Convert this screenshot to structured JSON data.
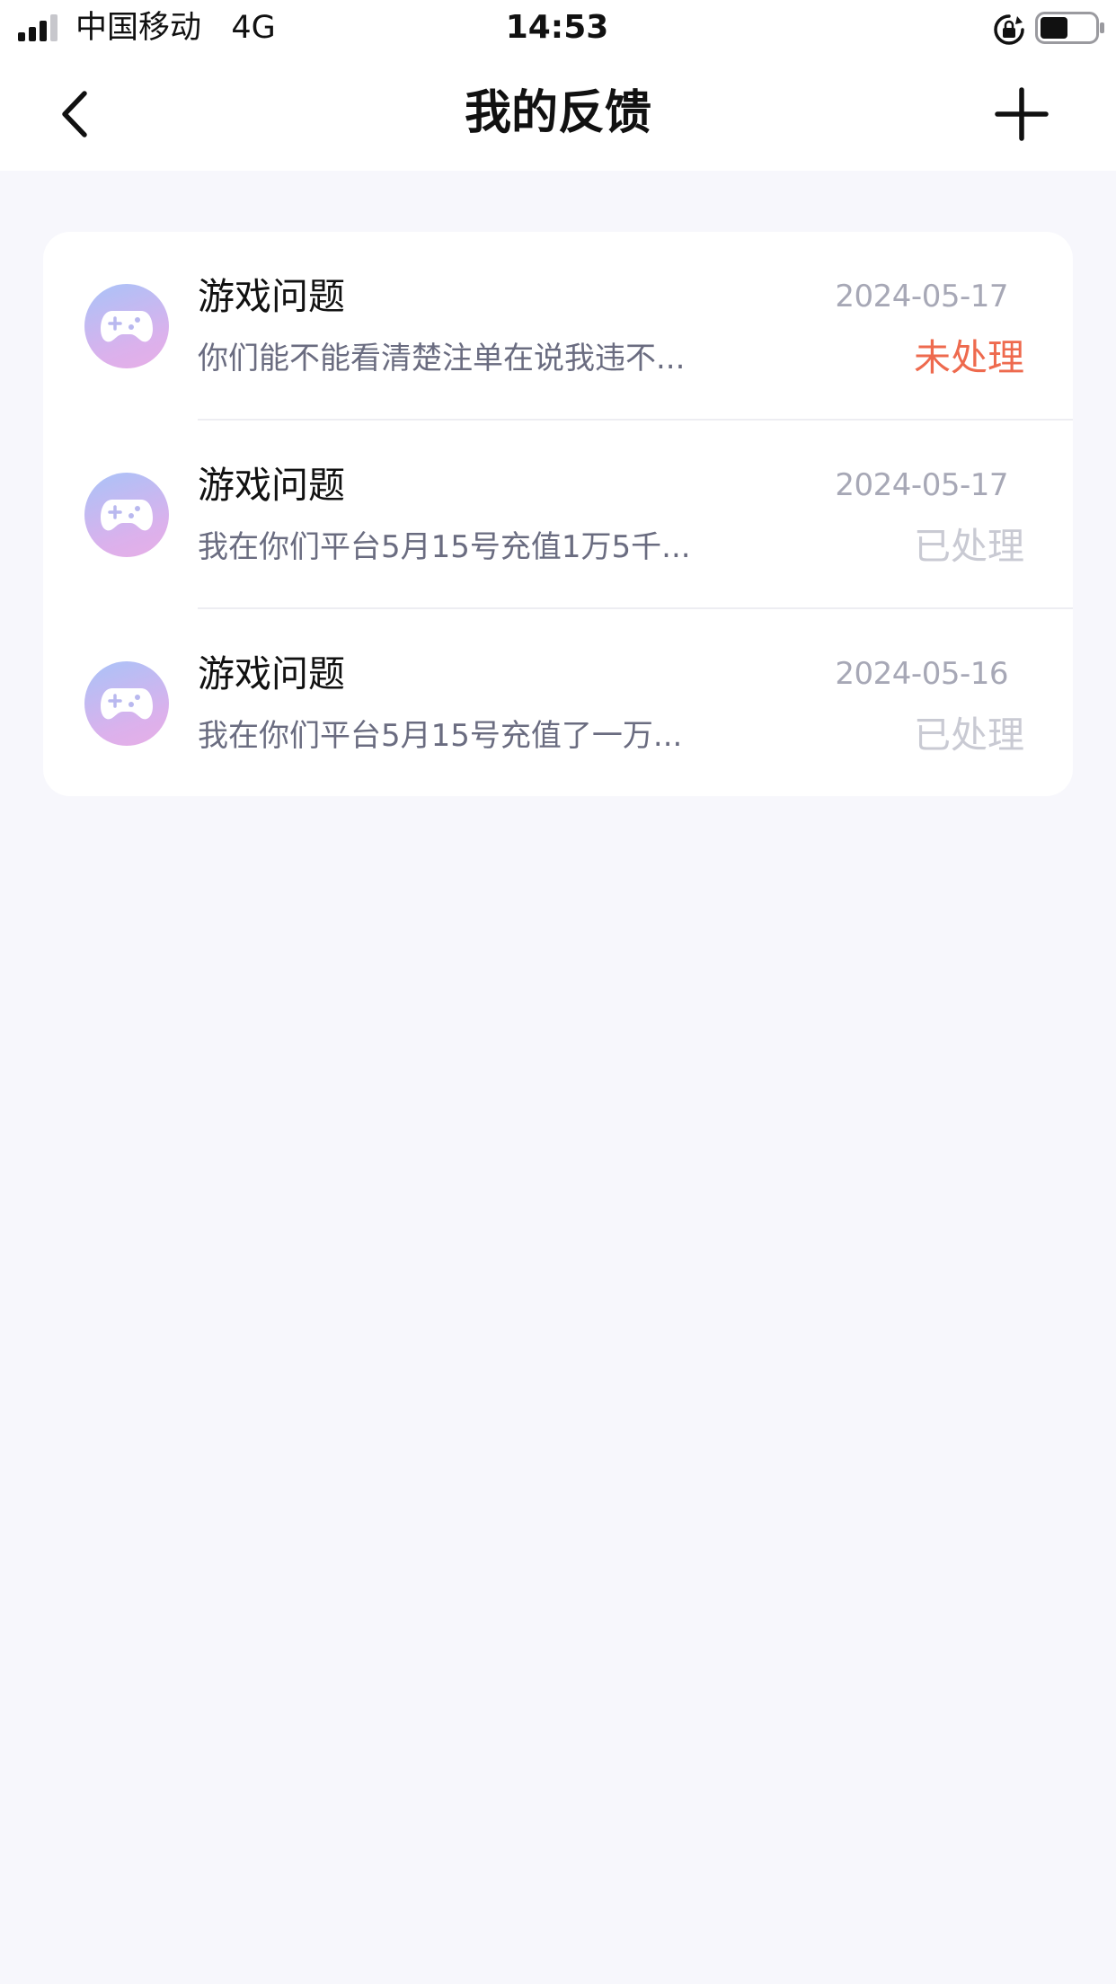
{
  "status_bar": {
    "carrier": "中国移动",
    "network": "4G",
    "time": "14:53",
    "icons": [
      "signal-icon",
      "rotation-lock-icon",
      "battery-icon"
    ]
  },
  "nav": {
    "title": "我的反馈",
    "back_icon": "chevron-left-icon",
    "add_icon": "plus-icon"
  },
  "feedback_list": [
    {
      "icon": "gamepad-icon",
      "title": "游戏问题",
      "date": "2024-05-17",
      "preview": "你们能不能看清楚注单在说我违不...",
      "status": "未处理",
      "status_type": "pending"
    },
    {
      "icon": "gamepad-icon",
      "title": "游戏问题",
      "date": "2024-05-17",
      "preview": "我在你们平台5月15号充值1万5千...",
      "status": "已处理",
      "status_type": "done"
    },
    {
      "icon": "gamepad-icon",
      "title": "游戏问题",
      "date": "2024-05-16",
      "preview": "我在你们平台5月15号充值了一万...",
      "status": "已处理",
      "status_type": "done"
    }
  ],
  "colors": {
    "background": "#f7f7fc",
    "status_pending": "#ee6a4e",
    "status_done": "#c9cad3",
    "avatar_gradient_start": "#a9c3f8",
    "avatar_gradient_end": "#e7aee6"
  }
}
